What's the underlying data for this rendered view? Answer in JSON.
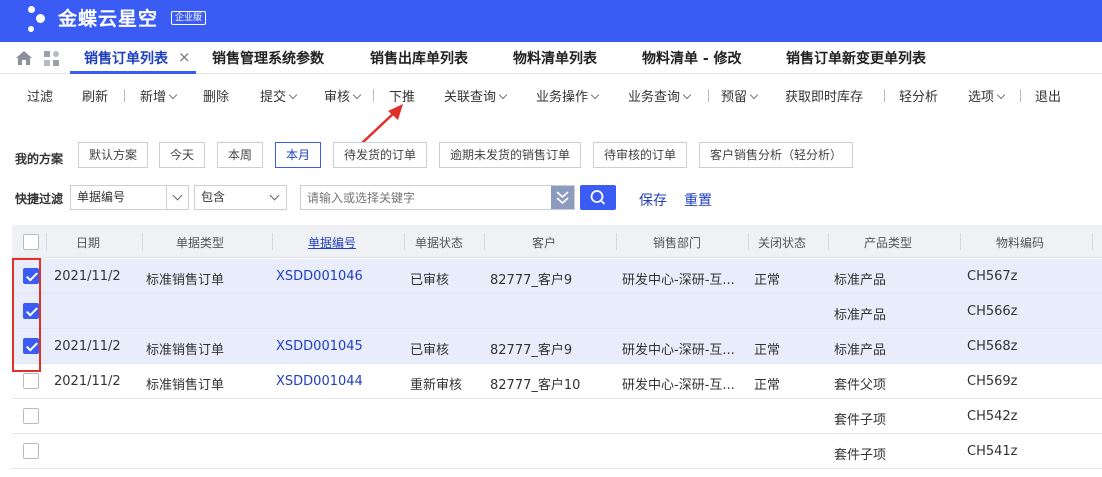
{
  "brand": {
    "title": "金蝶云星空",
    "badge": "企业版"
  },
  "tabs": [
    {
      "label": "销售订单列表",
      "active": true
    },
    {
      "label": "销售管理系统参数"
    },
    {
      "label": "销售出库单列表"
    },
    {
      "label": "物料清单列表"
    },
    {
      "label": "物料清单 - 修改"
    },
    {
      "label": "销售订单新变更单列表"
    }
  ],
  "toolbar": {
    "filter": "过滤",
    "refresh": "刷新",
    "add": "新增",
    "delete": "删除",
    "submit": "提交",
    "audit": "审核",
    "push_down": "下推",
    "related_query": "关联查询",
    "business_ops": "业务操作",
    "business_query": "业务查询",
    "reserve": "预留",
    "instant_stock": "获取即时库存",
    "light_analysis": "轻分析",
    "options": "选项",
    "exit": "退出"
  },
  "schemes": {
    "label": "我的方案",
    "items": [
      "默认方案",
      "今天",
      "本周",
      "本月",
      "待发货的订单",
      "逾期未发货的销售订单",
      "待审核的订单",
      "客户销售分析（轻分析）"
    ],
    "active": "本月"
  },
  "quick_filter": {
    "label": "快捷过滤",
    "field": "单据编号",
    "operator": "包含",
    "placeholder": "请输入或选择关键字",
    "save": "保存",
    "reset": "重置"
  },
  "table": {
    "columns": [
      "日期",
      "单据类型",
      "单据编号",
      "单据状态",
      "客户",
      "销售部门",
      "关闭状态",
      "产品类型",
      "物料编码"
    ],
    "rows": [
      {
        "checked": true,
        "date": "2021/11/2",
        "type": "标准销售订单",
        "number": "XSDD001046",
        "status": "已审核",
        "customer": "82777_客户9",
        "dept": "研发中心-深研-互...",
        "close": "正常",
        "product": "标准产品",
        "material": "CH567z"
      },
      {
        "checked": true,
        "date": "",
        "type": "",
        "number": "",
        "status": "",
        "customer": "",
        "dept": "",
        "close": "",
        "product": "标准产品",
        "material": "CH566z"
      },
      {
        "checked": true,
        "date": "2021/11/2",
        "type": "标准销售订单",
        "number": "XSDD001045",
        "status": "已审核",
        "customer": "82777_客户9",
        "dept": "研发中心-深研-互...",
        "close": "正常",
        "product": "标准产品",
        "material": "CH568z"
      },
      {
        "checked": false,
        "date": "2021/11/2",
        "type": "标准销售订单",
        "number": "XSDD001044",
        "status": "重新审核",
        "customer": "82777_客户10",
        "dept": "研发中心-深研-互...",
        "close": "正常",
        "product": "套件父项",
        "material": "CH569z"
      },
      {
        "checked": false,
        "date": "",
        "type": "",
        "number": "",
        "status": "",
        "customer": "",
        "dept": "",
        "close": "",
        "product": "套件子项",
        "material": "CH542z"
      },
      {
        "checked": false,
        "date": "",
        "type": "",
        "number": "",
        "status": "",
        "customer": "",
        "dept": "",
        "close": "",
        "product": "套件子项",
        "material": "CH541z"
      }
    ]
  },
  "colors": {
    "brand": "#3b5bf5",
    "link": "#1f3fbf",
    "highlight_box": "#e0302a"
  }
}
